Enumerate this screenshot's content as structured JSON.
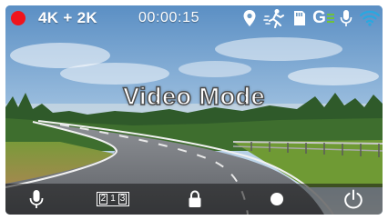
{
  "status_bar": {
    "recording_indicator_color": "#f0141c",
    "resolution": "4K + 2K",
    "timer": "00:00:15",
    "gps_icon": "location-pin-icon",
    "motion_icon": "motion-detection-icon",
    "sd_card_icon": "sd-card-icon",
    "g_sensor_label": "G",
    "microphone_icon": "microphone-icon",
    "wifi_icon": "wifi-icon",
    "wifi_color": "#29a8e0"
  },
  "main": {
    "mode_title": "Video Mode"
  },
  "bottom_bar": {
    "buttons": [
      {
        "icon": "microphone-icon"
      },
      {
        "icon": "split-view-icon",
        "digits": [
          "2",
          "1",
          "3"
        ]
      },
      {
        "icon": "lock-icon"
      },
      {
        "icon": "record-dot-icon"
      },
      {
        "icon": "power-icon"
      }
    ]
  }
}
